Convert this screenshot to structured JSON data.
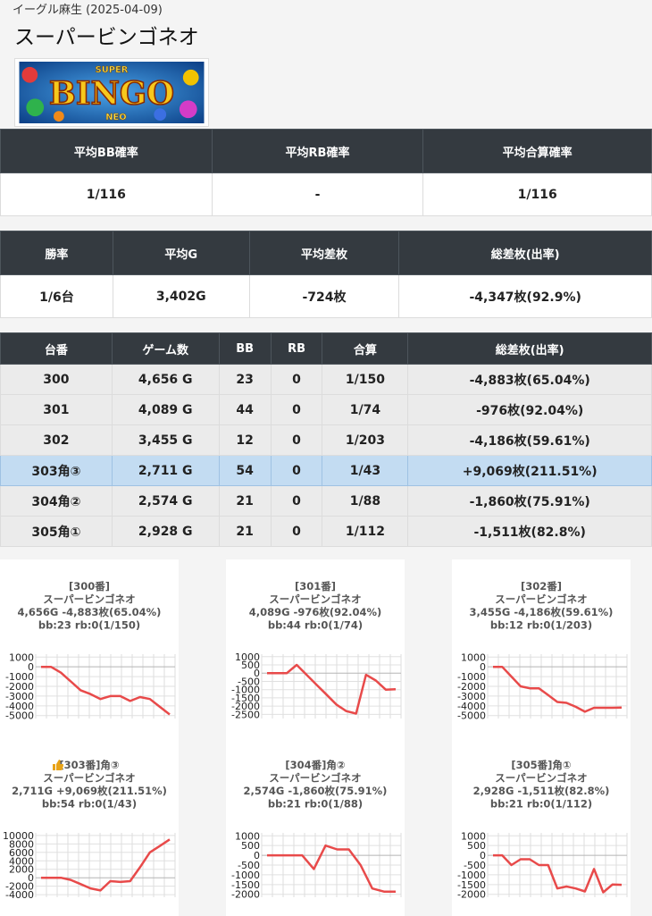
{
  "header": {
    "store_date": "イーグル麻生 (2025-04-09)",
    "machine_title": "スーパービンゴネオ",
    "banner": {
      "text_super": "SUPER",
      "text_bingo": "BINGO",
      "text_neo": "NEO"
    }
  },
  "summary_prob": {
    "headers": [
      "平均BB確率",
      "平均RB確率",
      "平均合算確率"
    ],
    "values": [
      "1/116",
      "-",
      "1/116"
    ]
  },
  "summary_stats": {
    "headers": [
      "勝率",
      "平均G",
      "平均差枚",
      "総差枚(出率)"
    ],
    "values": [
      "1/6台",
      "3,402G",
      "-724枚",
      "-4,347枚(92.9%)"
    ]
  },
  "machines_table": {
    "headers": [
      "台番",
      "ゲーム数",
      "BB",
      "RB",
      "合算",
      "総差枚(出率)"
    ],
    "rows": [
      [
        "300",
        "4,656 G",
        "23",
        "0",
        "1/150",
        "-4,883枚(65.04%)"
      ],
      [
        "301",
        "4,089 G",
        "44",
        "0",
        "1/74",
        "-976枚(92.04%)"
      ],
      [
        "302",
        "3,455 G",
        "12",
        "0",
        "1/203",
        "-4,186枚(59.61%)"
      ],
      [
        "303角③",
        "2,711 G",
        "54",
        "0",
        "1/43",
        "+9,069枚(211.51%)"
      ],
      [
        "304角②",
        "2,574 G",
        "21",
        "0",
        "1/88",
        "-1,860枚(75.91%)"
      ],
      [
        "305角①",
        "2,928 G",
        "21",
        "0",
        "1/112",
        "-1,511枚(82.8%)"
      ]
    ],
    "highlight_row": 3,
    "highlight_color": "#c3dcf2"
  },
  "colors": {
    "header_bg": "#343a40",
    "line": "#e84a4a"
  },
  "chart_data": [
    {
      "type": "line",
      "title_lines": [
        "[300番]",
        "スーパービンゴネオ",
        "4,656G -4,883枚(65.04%)",
        "bb:23 rb:0(1/150)"
      ],
      "yticks": [
        1000,
        0,
        -1000,
        -2000,
        -3000,
        -4000,
        -5000
      ],
      "ylim": [
        -5300,
        1300
      ],
      "values": [
        0,
        0,
        -600,
        -1500,
        -2400,
        -2800,
        -3300,
        -3000,
        -3000,
        -3500,
        -3100,
        -3300,
        -4100,
        -4883
      ]
    },
    {
      "type": "line",
      "title_lines": [
        "[301番]",
        "スーパービンゴネオ",
        "4,089G -976枚(92.04%)",
        "bb:44 rb:0(1/74)"
      ],
      "yticks": [
        1000,
        500,
        0,
        -500,
        -1000,
        -1500,
        -2000,
        -2500
      ],
      "ylim": [
        -2750,
        1150
      ],
      "values": [
        0,
        0,
        0,
        500,
        -100,
        -700,
        -1300,
        -1900,
        -2300,
        -2450,
        -100,
        -450,
        -1000,
        -976
      ]
    },
    {
      "type": "line",
      "title_lines": [
        "[302番]",
        "スーパービンゴネオ",
        "3,455G -4,186枚(59.61%)",
        "bb:12 rb:0(1/203)"
      ],
      "yticks": [
        1000,
        0,
        -1000,
        -2000,
        -3000,
        -4000,
        -5000
      ],
      "ylim": [
        -5300,
        1300
      ],
      "values": [
        0,
        0,
        -1000,
        -2000,
        -2200,
        -2200,
        -2900,
        -3600,
        -3700,
        -4100,
        -4600,
        -4200,
        -4200,
        -4200,
        -4186
      ]
    },
    {
      "type": "line",
      "icon": "thumbs-up",
      "title_lines": [
        "[303番]角③",
        "スーパービンゴネオ",
        "2,711G +9,069枚(211.51%)",
        "bb:54 rb:0(1/43)"
      ],
      "yticks": [
        10000,
        8000,
        6000,
        4000,
        2000,
        0,
        -2000,
        -4000
      ],
      "ylim": [
        -4600,
        10600
      ],
      "values": [
        0,
        0,
        0,
        -500,
        -1500,
        -2500,
        -3000,
        -800,
        -1000,
        -800,
        2500,
        6000,
        7500,
        9069
      ]
    },
    {
      "type": "line",
      "title_lines": [
        "[304番]角②",
        "スーパービンゴネオ",
        "2,574G -1,860枚(75.91%)",
        "bb:21 rb:0(1/88)"
      ],
      "yticks": [
        1000,
        500,
        0,
        -500,
        -1000,
        -1500,
        -2000
      ],
      "ylim": [
        -2150,
        1150
      ],
      "values": [
        0,
        0,
        0,
        0,
        -700,
        500,
        300,
        300,
        -500,
        -1700,
        -1860,
        -1860
      ]
    },
    {
      "type": "line",
      "title_lines": [
        "[305番]角①",
        "スーパービンゴネオ",
        "2,928G -1,511枚(82.8%)",
        "bb:21 rb:0(1/112)"
      ],
      "yticks": [
        1000,
        500,
        0,
        -500,
        -1000,
        -1500,
        -2000
      ],
      "ylim": [
        -2150,
        1150
      ],
      "values": [
        0,
        0,
        -500,
        -200,
        -200,
        -500,
        -500,
        -1700,
        -1600,
        -1700,
        -1850,
        -700,
        -1900,
        -1500,
        -1511
      ]
    }
  ]
}
